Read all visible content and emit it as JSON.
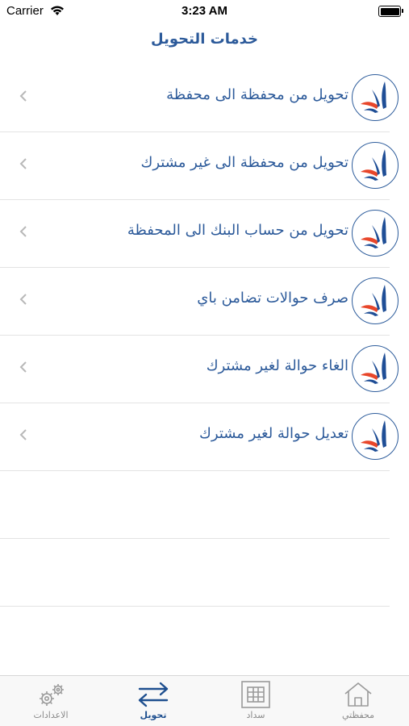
{
  "status_bar": {
    "carrier": "Carrier",
    "time": "3:23 AM"
  },
  "header": {
    "title": "خدمات التحويل"
  },
  "services": [
    {
      "label": "تحويل من محفظة الى محفظة"
    },
    {
      "label": "تحويل من محفظة الى غير مشترك"
    },
    {
      "label": "تحويل من حساب البنك الى المحفظة"
    },
    {
      "label": "صرف حوالات تضامن باي"
    },
    {
      "label": "الغاء حوالة لغير مشترك"
    },
    {
      "label": "تعديل حوالة لغير مشترك"
    }
  ],
  "tabs": [
    {
      "label": "الاعدادات",
      "icon": "gears-icon"
    },
    {
      "label": "تحويل",
      "icon": "transfer-arrows-icon",
      "active": true
    },
    {
      "label": "سداد",
      "icon": "bill-icon"
    },
    {
      "label": "محفظتي",
      "icon": "home-icon"
    }
  ],
  "colors": {
    "accent": "#2c5a9a",
    "logo_blue": "#1f4e96",
    "logo_red": "#e8462a"
  }
}
